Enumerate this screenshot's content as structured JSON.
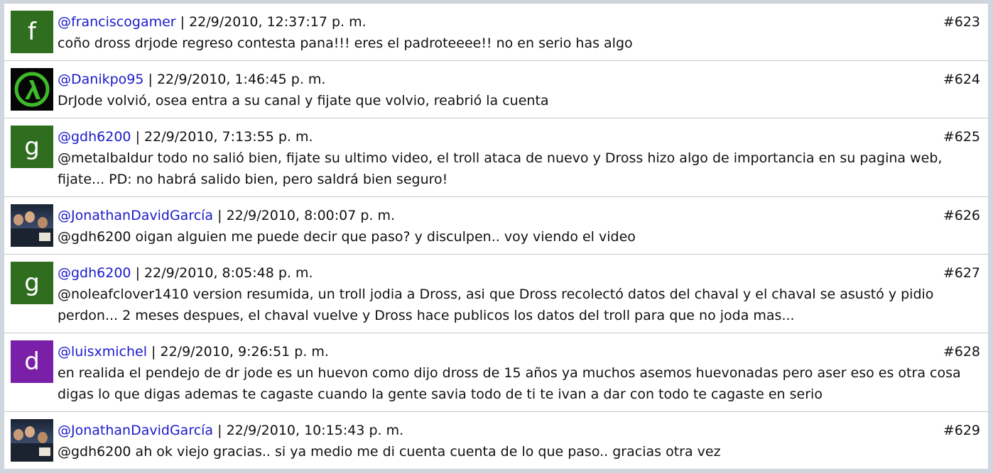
{
  "comments": [
    {
      "user": "@franciscogamer",
      "date": "22/9/2010, 12:37:17 p. m.",
      "number": "#623",
      "text": "coño dross drjode regreso contesta pana!!! eres el padroteeee!! no en serio has algo",
      "avatar": {
        "type": "letter",
        "letter": "f",
        "color": "#2f6d1f"
      }
    },
    {
      "user": "@Danikpo95",
      "date": "22/9/2010, 1:46:45 p. m.",
      "number": "#624",
      "text": "DrJode volvió, osea entra a su canal y fijate que volvio, reabrió la cuenta",
      "avatar": {
        "type": "lambda-icon",
        "color": "#3fb82a"
      }
    },
    {
      "user": "@gdh6200",
      "date": "22/9/2010, 7:13:55 p. m.",
      "number": "#625",
      "text": "@metalbaldur todo no salió bien, fijate su ultimo video, el troll ataca de nuevo y Dross hizo algo de importancia en su pagina web, fijate... PD: no habrá salido bien, pero saldrá bien seguro!",
      "avatar": {
        "type": "letter",
        "letter": "g",
        "color": "#2f6d1f"
      }
    },
    {
      "user": "@JonathanDavidGarcía",
      "date": "22/9/2010, 8:00:07 p. m.",
      "number": "#626",
      "text": "@gdh6200 oigan alguien me puede decir que paso? y disculpen.. voy viendo el video",
      "avatar": {
        "type": "photo"
      }
    },
    {
      "user": "@gdh6200",
      "date": "22/9/2010, 8:05:48 p. m.",
      "number": "#627",
      "text": "@noleafclover1410 version resumida, un troll jodia a Dross, asi que Dross recolectó datos del chaval y el chaval se asustó y pidio perdon... 2 meses despues, el chaval vuelve y Dross hace publicos los datos del troll para que no joda mas...",
      "avatar": {
        "type": "letter",
        "letter": "g",
        "color": "#2f6d1f"
      }
    },
    {
      "user": "@luisxmichel",
      "date": "22/9/2010, 9:26:51 p. m.",
      "number": "#628",
      "text": "en realida el pendejo de dr jode es un huevon como dijo dross de 15 años ya muchos asemos huevonadas pero aser eso es otra cosa digas lo que digas ademas te cagaste cuando la gente savia todo de ti te ivan a dar con todo te cagaste en serio",
      "avatar": {
        "type": "letter",
        "letter": "d",
        "color": "#7a1fa8"
      }
    },
    {
      "user": "@JonathanDavidGarcía",
      "date": "22/9/2010, 10:15:43 p. m.",
      "number": "#629",
      "text": "@gdh6200 ah ok viejo gracias.. si ya medio me di cuenta cuenta de lo que paso.. gracias otra vez",
      "avatar": {
        "type": "photo"
      }
    }
  ]
}
